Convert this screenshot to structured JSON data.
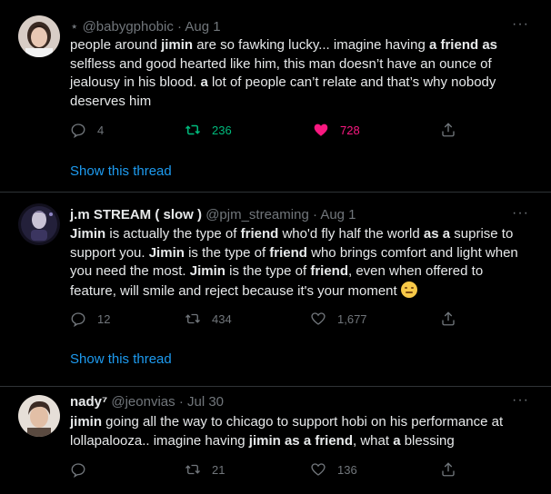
{
  "tweets": [
    {
      "name": "",
      "handle_prefix": "⋆",
      "handle": "@babygphobic",
      "dot": "·",
      "date": "Aug 1",
      "more": "···",
      "segments": [
        {
          "t": "people around ",
          "b": false
        },
        {
          "t": "jimin",
          "b": true
        },
        {
          "t": " are so fawking lucky... imagine having ",
          "b": false
        },
        {
          "t": "a friend as",
          "b": true
        },
        {
          "t": " selfless and good hearted like him, this man doesn’t have an ounce of jealousy in his blood. ",
          "b": false
        },
        {
          "t": "a",
          "b": true
        },
        {
          "t": " lot of people can’t relate and that’s why nobody deserves him",
          "b": false
        }
      ],
      "replies": "4",
      "retweets": "236",
      "likes": "728",
      "liked": true,
      "retweeted": true,
      "thread": "Show this thread"
    },
    {
      "name": "j.m STREAM ( slow )",
      "handle": "@pjm_streaming",
      "dot": "·",
      "date": "Aug 1",
      "more": "···",
      "segments": [
        {
          "t": "Jimin",
          "b": true
        },
        {
          "t": " is actually the type of ",
          "b": false
        },
        {
          "t": "friend",
          "b": true
        },
        {
          "t": " who'd fly half the world ",
          "b": false
        },
        {
          "t": "as a",
          "b": true
        },
        {
          "t": " suprise to support you. ",
          "b": false
        },
        {
          "t": "Jimin",
          "b": true
        },
        {
          "t": " is the type of ",
          "b": false
        },
        {
          "t": "friend",
          "b": true
        },
        {
          "t": " who brings comfort and light when you need the most. ",
          "b": false
        },
        {
          "t": "Jimin",
          "b": true
        },
        {
          "t": " is the type of ",
          "b": false
        },
        {
          "t": "friend",
          "b": true
        },
        {
          "t": ", even when offered to feature, will smile and reject because it's your moment ",
          "b": false
        }
      ],
      "emoji": "relieved-face-emoji",
      "replies": "12",
      "retweets": "434",
      "likes": "1,677",
      "liked": false,
      "retweeted": false,
      "thread": "Show this thread"
    },
    {
      "name": "nady⁷",
      "handle": "@jeonvias",
      "dot": "·",
      "date": "Jul 30",
      "more": "···",
      "segments": [
        {
          "t": "jimin",
          "b": true
        },
        {
          "t": " going all the way to chicago to support hobi on his performance at lollapalooza.. imagine having ",
          "b": false
        },
        {
          "t": "jimin as a friend",
          "b": true
        },
        {
          "t": ", what ",
          "b": false
        },
        {
          "t": "a",
          "b": true
        },
        {
          "t": " blessing",
          "b": false
        }
      ],
      "replies": "",
      "retweets": "21",
      "likes": "136",
      "liked": false,
      "retweeted": false,
      "thread": ""
    }
  ],
  "colors": {
    "background": "#000000",
    "text": "#e7e9ea",
    "muted": "#71767b",
    "link": "#1d9bf0",
    "retweet": "#00ba7c",
    "like": "#f91880",
    "separator": "#2f3336"
  }
}
